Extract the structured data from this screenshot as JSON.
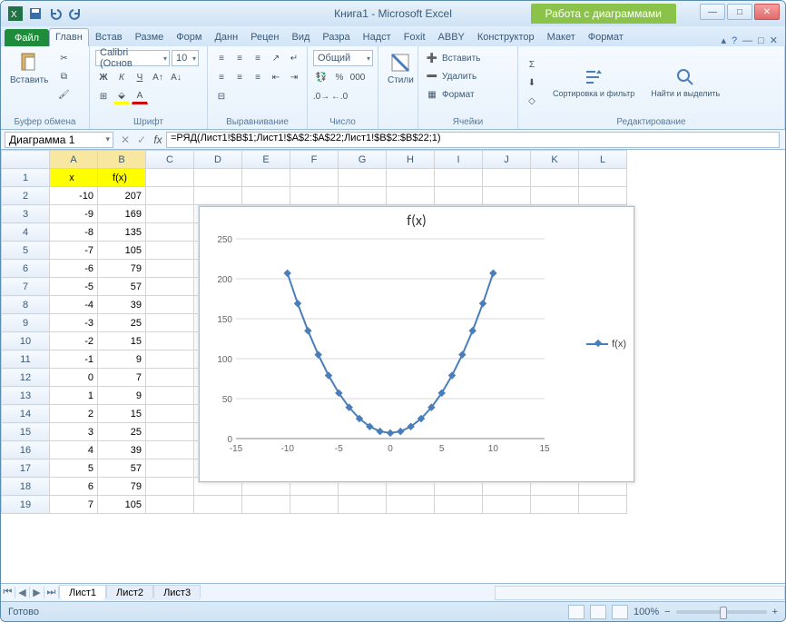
{
  "window": {
    "doc_title": "Книга1",
    "app_title": "Microsoft Excel",
    "chart_tools": "Работа с диаграммами"
  },
  "tabs": {
    "file": "Файл",
    "items": [
      "Главн",
      "Встав",
      "Разме",
      "Форм",
      "Данн",
      "Рецен",
      "Вид",
      "Разра",
      "Надст",
      "Foxit",
      "ABBY"
    ],
    "chart_items": [
      "Конструктор",
      "Макет",
      "Формат"
    ]
  },
  "ribbon": {
    "clipboard": {
      "paste": "Вставить",
      "label": "Буфер обмена"
    },
    "font": {
      "name": "Calibri (Основ",
      "size": "10",
      "label": "Шрифт"
    },
    "align": {
      "label": "Выравнивание"
    },
    "number": {
      "format": "Общий",
      "label": "Число"
    },
    "styles": {
      "btn": "Стили",
      "label": ""
    },
    "cells": {
      "insert": "Вставить",
      "delete": "Удалить",
      "format": "Формат",
      "label": "Ячейки"
    },
    "editing": {
      "sort": "Сортировка и фильтр",
      "find": "Найти и выделить",
      "label": "Редактирование"
    }
  },
  "formula": {
    "name_box": "Диаграмма 1",
    "fx": "fx",
    "value": "=РЯД(Лист1!$B$1;Лист1!$A$2:$A$22;Лист1!$B$2:$B$22;1)"
  },
  "columns": [
    "A",
    "B",
    "C",
    "D",
    "E",
    "F",
    "G",
    "H",
    "I",
    "J",
    "K",
    "L"
  ],
  "headers": {
    "x": "x",
    "fx": "f(x)"
  },
  "rows": [
    {
      "n": 1
    },
    {
      "n": 2,
      "x": -10,
      "fx": 207
    },
    {
      "n": 3,
      "x": -9,
      "fx": 169
    },
    {
      "n": 4,
      "x": -8,
      "fx": 135
    },
    {
      "n": 5,
      "x": -7,
      "fx": 105
    },
    {
      "n": 6,
      "x": -6,
      "fx": 79
    },
    {
      "n": 7,
      "x": -5,
      "fx": 57
    },
    {
      "n": 8,
      "x": -4,
      "fx": 39
    },
    {
      "n": 9,
      "x": -3,
      "fx": 25
    },
    {
      "n": 10,
      "x": -2,
      "fx": 15
    },
    {
      "n": 11,
      "x": -1,
      "fx": 9
    },
    {
      "n": 12,
      "x": 0,
      "fx": 7
    },
    {
      "n": 13,
      "x": 1,
      "fx": 9
    },
    {
      "n": 14,
      "x": 2,
      "fx": 15
    },
    {
      "n": 15,
      "x": 3,
      "fx": 25
    },
    {
      "n": 16,
      "x": 4,
      "fx": 39
    },
    {
      "n": 17,
      "x": 5,
      "fx": 57
    },
    {
      "n": 18,
      "x": 6,
      "fx": 79
    },
    {
      "n": 19,
      "x": 7,
      "fx": 105
    }
  ],
  "chart_data": {
    "type": "line",
    "title": "f(x)",
    "x": [
      -10,
      -9,
      -8,
      -7,
      -6,
      -5,
      -4,
      -3,
      -2,
      -1,
      0,
      1,
      2,
      3,
      4,
      5,
      6,
      7,
      8,
      9,
      10
    ],
    "series": [
      {
        "name": "f(x)",
        "values": [
          207,
          169,
          135,
          105,
          79,
          57,
          39,
          25,
          15,
          9,
          7,
          9,
          15,
          25,
          39,
          57,
          79,
          105,
          135,
          169,
          207
        ]
      }
    ],
    "xlim": [
      -15,
      15
    ],
    "ylim": [
      0,
      250
    ],
    "xticks": [
      -15,
      -10,
      -5,
      0,
      5,
      10,
      15
    ],
    "yticks": [
      0,
      50,
      100,
      150,
      200,
      250
    ],
    "color": "#4a7ebb",
    "legend": "f(x)"
  },
  "sheets": {
    "active": "Лист1",
    "others": [
      "Лист2",
      "Лист3"
    ]
  },
  "status": {
    "ready": "Готово",
    "zoom": "100%"
  }
}
